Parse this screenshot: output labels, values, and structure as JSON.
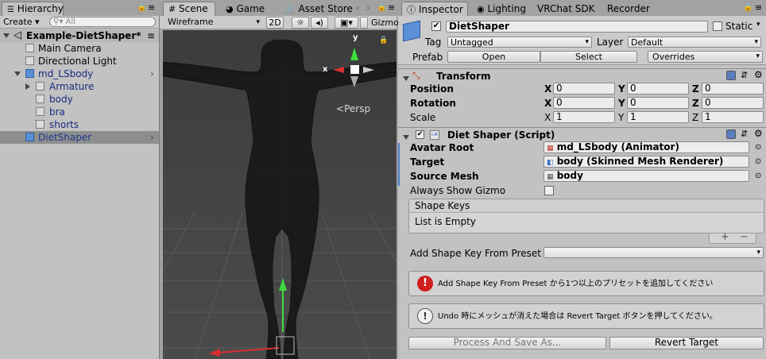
{
  "hierarchy": {
    "tab_label": "Hierarchy",
    "create_label": "Create ▾",
    "search_placeholder": "All",
    "scene_name": "Example-DietShaper*",
    "items": [
      {
        "label": "Main Camera"
      },
      {
        "label": "Directional Light"
      },
      {
        "label": "md_LSbody"
      },
      {
        "label": "Armature"
      },
      {
        "label": "body"
      },
      {
        "label": "bra"
      },
      {
        "label": "shorts"
      },
      {
        "label": "DietShaper"
      }
    ]
  },
  "scene": {
    "tabs": [
      {
        "label": "Scene"
      },
      {
        "label": "Game"
      },
      {
        "label": "Asset Store"
      }
    ],
    "draw_mode": "Wireframe",
    "btn_2d": "2D",
    "gizmos_label": "Gizmo",
    "persp_label": "Persp",
    "axis_y": "y",
    "axis_x": "x"
  },
  "inspector": {
    "tabs": [
      {
        "label": "Inspector"
      },
      {
        "label": "Lighting"
      },
      {
        "label": "VRChat SDK"
      },
      {
        "label": "Recorder"
      }
    ],
    "object_name": "DietShaper",
    "static_label": "Static",
    "tag_label": "Tag",
    "tag_value": "Untagged",
    "layer_label": "Layer",
    "layer_value": "Default",
    "prefab_label": "Prefab",
    "open_label": "Open",
    "select_label": "Select",
    "overrides_label": "Overrides",
    "transform": {
      "title": "Transform",
      "position_label": "Position",
      "rotation_label": "Rotation",
      "scale_label": "Scale",
      "position": {
        "x": "0",
        "y": "0",
        "z": "0"
      },
      "rotation": {
        "x": "0",
        "y": "0",
        "z": "0"
      },
      "scale": {
        "x": "1",
        "y": "1",
        "z": "1"
      },
      "x": "X",
      "y": "Y",
      "z": "Z"
    },
    "script": {
      "title": "Diet Shaper (Script)",
      "avatar_root_label": "Avatar Root",
      "avatar_root_value": "md_LSbody (Animator)",
      "target_label": "Target",
      "target_value": "body (Skinned Mesh Renderer)",
      "source_mesh_label": "Source Mesh",
      "source_mesh_value": "body",
      "always_show_label": "Always Show Gizmo",
      "shape_keys_header": "Shape Keys",
      "list_empty": "List is Empty",
      "plus": "+",
      "minus": "−",
      "add_preset_label": "Add Shape Key From Preset",
      "help_error": "Add Shape Key From Preset から1つ以上のプリセットを追加してください",
      "help_info": "Undo 時にメッシュが消えた場合は Revert Target ボタンを押してください。",
      "process_label": "Process And Save As...",
      "revert_label": "Revert Target"
    }
  }
}
